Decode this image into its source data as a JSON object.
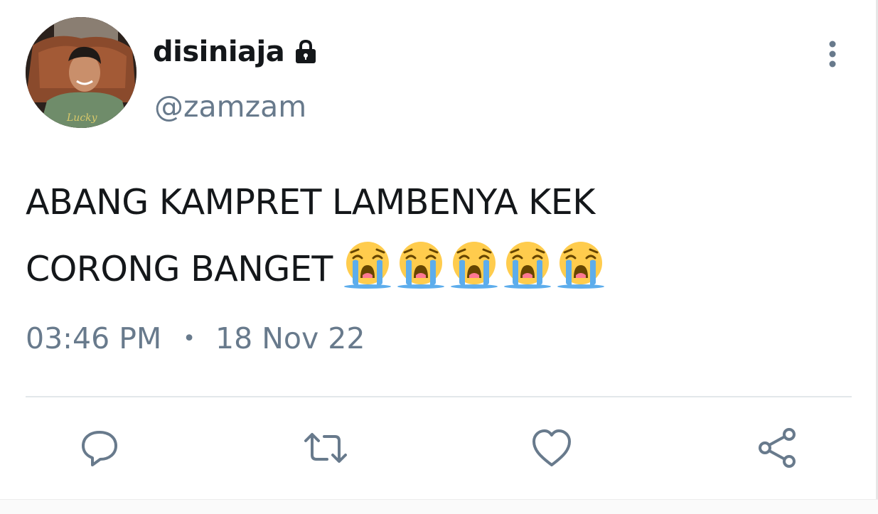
{
  "user": {
    "display_name": "disiniaja",
    "handle": "@zamzam",
    "avatar_shirt_text": "Lucky"
  },
  "tweet": {
    "text_line1": "ABANG KAMPRET LAMBENYA KEK",
    "text_line2": "CORONG BANGET",
    "emoji": [
      "loudly-crying-face",
      "loudly-crying-face",
      "loudly-crying-face",
      "loudly-crying-face",
      "loudly-crying-face"
    ],
    "time": "03:46 PM",
    "separator": "•",
    "date": "18 Nov 22"
  },
  "icons": {
    "lock": "lock-icon",
    "more": "more-vertical-icon",
    "reply": "reply-icon",
    "retweet": "retweet-icon",
    "like": "heart-icon",
    "share": "share-icon"
  },
  "colors": {
    "text": "#14171a",
    "secondary_text": "#687a8c",
    "icon": "#687a8c",
    "divider": "#e3e7ea",
    "emoji_yellow": "#ffcc4d",
    "emoji_tears": "#5dadec"
  }
}
